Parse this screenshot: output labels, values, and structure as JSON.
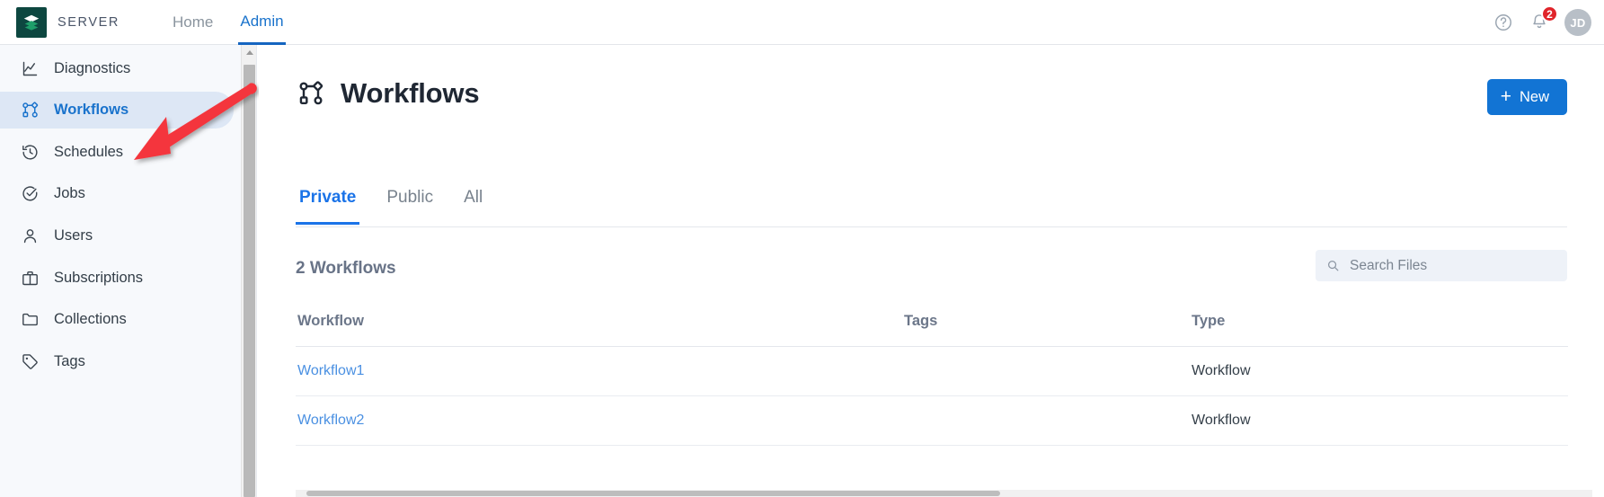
{
  "topbar": {
    "brand_name": "SERVER",
    "brand_icon": "layers-stack-icon",
    "nav": [
      {
        "label": "Home",
        "active": false
      },
      {
        "label": "Admin",
        "active": true
      }
    ],
    "help_icon": "help-circle-icon",
    "notifications_icon": "bell-icon",
    "notifications_count": "2",
    "avatar_initials": "JD"
  },
  "sidebar": {
    "items": [
      {
        "label": "Diagnostics",
        "icon": "chart-line-icon",
        "active": false
      },
      {
        "label": "Workflows",
        "icon": "workflow-icon",
        "active": true
      },
      {
        "label": "Schedules",
        "icon": "clock-history-icon",
        "active": false
      },
      {
        "label": "Jobs",
        "icon": "check-badge-icon",
        "active": false
      },
      {
        "label": "Users",
        "icon": "user-icon",
        "active": false
      },
      {
        "label": "Subscriptions",
        "icon": "briefcase-icon",
        "active": false
      },
      {
        "label": "Collections",
        "icon": "folder-icon",
        "active": false
      },
      {
        "label": "Tags",
        "icon": "tag-icon",
        "active": false
      }
    ],
    "scrollbar_up_icon": "scroll-up-arrow-icon"
  },
  "main": {
    "page_title": "Workflows",
    "page_title_icon": "workflow-icon",
    "new_button": {
      "label": "New",
      "plus": "+"
    },
    "tabs": [
      {
        "label": "Private",
        "active": true
      },
      {
        "label": "Public",
        "active": false
      },
      {
        "label": "All",
        "active": false
      }
    ],
    "list_count_label": "2 Workflows",
    "search": {
      "placeholder": "Search Files",
      "value": "",
      "icon": "search-icon"
    },
    "table": {
      "columns": [
        "Workflow",
        "Tags",
        "Type"
      ],
      "rows": [
        {
          "workflow": "Workflow1",
          "tags": "",
          "type": "Workflow"
        },
        {
          "workflow": "Workflow2",
          "tags": "",
          "type": "Workflow"
        }
      ]
    }
  },
  "annotation": {
    "arrow_color": "#f4363c",
    "points_to": "sidebar-item-workflows"
  },
  "colors": {
    "accent_blue": "#1274d4",
    "link_blue": "#4a90e2",
    "brand_dark_teal": "#0d4740",
    "badge_red": "#e0242a",
    "sidebar_bg": "#f7f9fc",
    "active_item_bg": "#dde7f5"
  }
}
